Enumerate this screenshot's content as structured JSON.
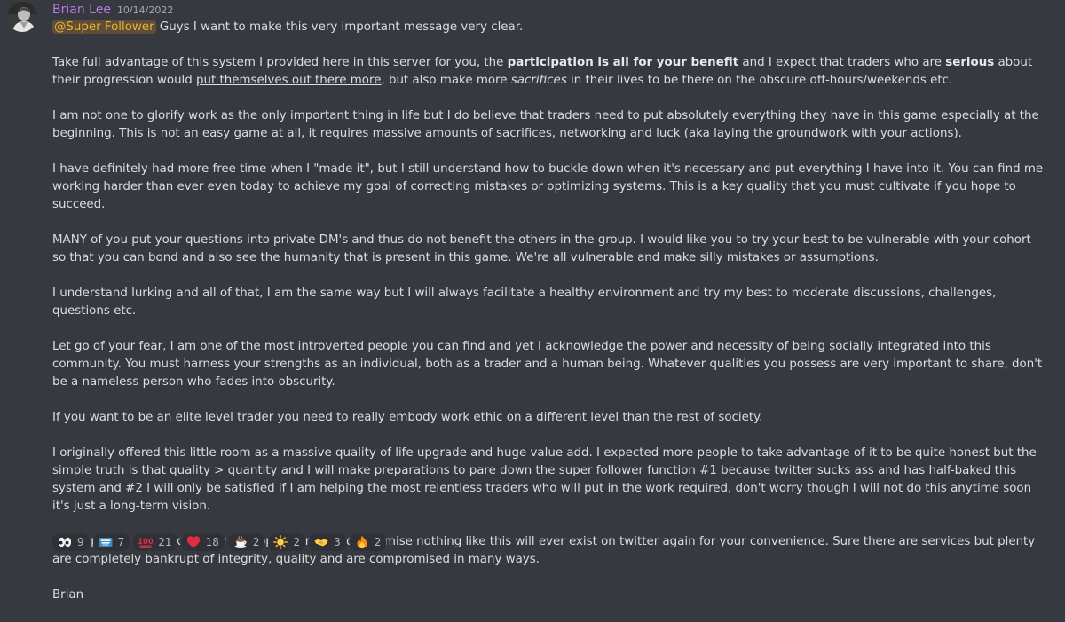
{
  "message": {
    "author": "Brian Lee",
    "timestamp": "10/14/2022",
    "mention": "@Super Follower",
    "line1": " Guys I want to make this very important message very clear.",
    "p2": {
      "a": "Take full advantage of this system I provided here in this server for you, the ",
      "b": "participation is all for your benefit",
      "c": " and I expect that traders who are ",
      "d": "serious",
      "e": " about their progression would ",
      "f": "put themselves out there more",
      "g": ", but also make more ",
      "h": "sacrifices",
      "i": " in their lives to be there on the obscure off-hours/weekends etc."
    },
    "p3": "I am not one to glorify work as the only important thing in life but I do believe that traders need to put absolutely everything they have in this game especially at the beginning. This is not an easy game at all, it requires massive amounts of sacrifices, networking and luck (aka laying the groundwork with your actions).",
    "p4": "I have definitely had more free time when I \"made it\", but I still understand how to buckle down when it's necessary and put everything I have into it. You can find me working harder than ever even today to achieve my goal of correcting mistakes or optimizing systems. This is a key quality that you must cultivate if you hope to succeed.",
    "p5": "MANY of you put your questions into private DM's and thus do not benefit the others in the group. I would like you to try your best to be vulnerable with your cohort so that you can bond and also see the humanity that is present in this game. We're all vulnerable and make silly mistakes or assumptions.",
    "p6": "I understand lurking and all of that, I am the same way but I will always facilitate a healthy environment and try my best to moderate discussions, challenges, questions etc.",
    "p7": "Let go of your fear, I am one of the most introverted people you can find and yet I acknowledge the power and necessity of being socially integrated into this community. You must harness your strengths as an individual, both as a trader and a human being. Whatever qualities you possess are very important to share, don't be a nameless person who fades into obscurity.",
    "p8": "If you want to be an elite level trader you need to really embody work ethic on a different level than the rest of society.",
    "p9": "I originally offered this little room as a massive quality of life upgrade and huge value add. I expected more people to take advantage of it to be quite honest but the simple truth is that quality > quantity and I will make preparations to pare down the super follower function #1 because twitter sucks ass and has half-baked this system and #2 I will only be satisfied if I am helping the most relentless traders who will put in the work required, don't worry though I will not do this anytime soon it's just a long-term vision.",
    "p10": "Step up! This is an extremely rare opportunity and I promise nothing like this will ever exist on twitter again for your convenience. Sure there are services but plenty are completely bankrupt of integrity, quality and are compromised in many ways.",
    "signoff": "Brian"
  },
  "reactions": [
    {
      "emoji": "eyes-icon",
      "count": "9"
    },
    {
      "emoji": "thank-you-icon",
      "count": "7"
    },
    {
      "emoji": "hundred-points-icon",
      "count": "21"
    },
    {
      "emoji": "red-heart-icon",
      "count": "18"
    },
    {
      "emoji": "coffee-icon",
      "count": "2"
    },
    {
      "emoji": "sun-icon",
      "count": "2"
    },
    {
      "emoji": "handshake-icon",
      "count": "3"
    },
    {
      "emoji": "fire-icon",
      "count": "2"
    }
  ],
  "colors": {
    "background": "#36393f",
    "author": "#b47ce0",
    "mention": "#f0b132",
    "reaction_bg": "#2f3136"
  }
}
